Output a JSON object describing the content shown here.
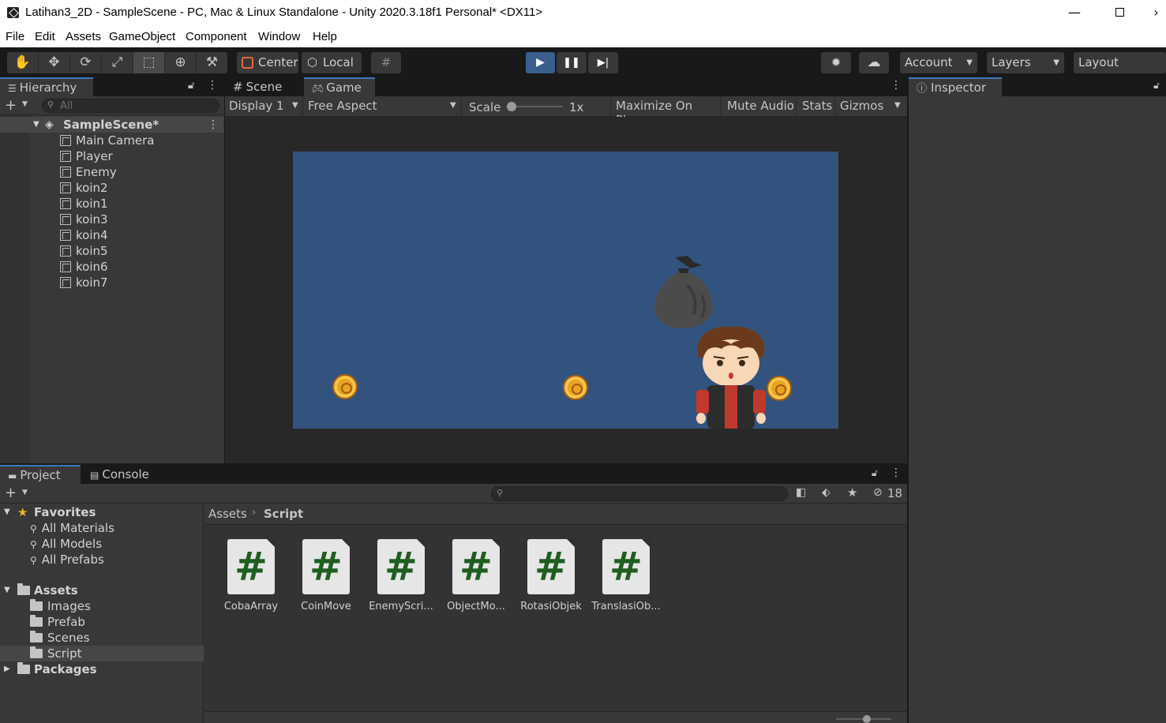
{
  "window": {
    "title": "Latihan3_2D - SampleScene - PC, Mac & Linux Standalone - Unity 2020.3.18f1 Personal* <DX11>",
    "minimize": "—",
    "maximize": "☐",
    "close": "›"
  },
  "menu": [
    "File",
    "Edit",
    "Assets",
    "GameObject",
    "Component",
    "Window",
    "Help"
  ],
  "toolbar": {
    "pivot": "Center",
    "space": "Local",
    "account": "Account",
    "layers": "Layers",
    "layout": "Layout"
  },
  "hierarchy": {
    "tab": "Hierarchy",
    "search_placeholder": "All",
    "scene": "SampleScene*",
    "objects": [
      "Main Camera",
      "Player",
      "Enemy",
      "koin2",
      "koin1",
      "koin3",
      "koin4",
      "koin5",
      "koin6",
      "koin7"
    ]
  },
  "game": {
    "tab_scene": "Scene",
    "tab_game": "Game",
    "display": "Display 1",
    "aspect": "Free Aspect",
    "scale_label": "Scale",
    "scale_value": "1x",
    "maximize": "Maximize On Play",
    "mute": "Mute Audio",
    "stats": "Stats",
    "gizmos": "Gizmos",
    "background_color": "#33537f"
  },
  "inspector": {
    "tab": "Inspector"
  },
  "project": {
    "tab_project": "Project",
    "tab_console": "Console",
    "hidden_count": "18",
    "favorites_label": "Favorites",
    "favorites": [
      "All Materials",
      "All Models",
      "All Prefabs"
    ],
    "assets_label": "Assets",
    "asset_folders": [
      "Images",
      "Prefab",
      "Scenes",
      "Script"
    ],
    "packages_label": "Packages",
    "breadcrumb_root": "Assets",
    "breadcrumb_current": "Script",
    "scripts": [
      "CobaArray",
      "CoinMove",
      "EnemyScri...",
      "ObjectMo...",
      "RotasiObjek",
      "TranslasiOb..."
    ]
  }
}
